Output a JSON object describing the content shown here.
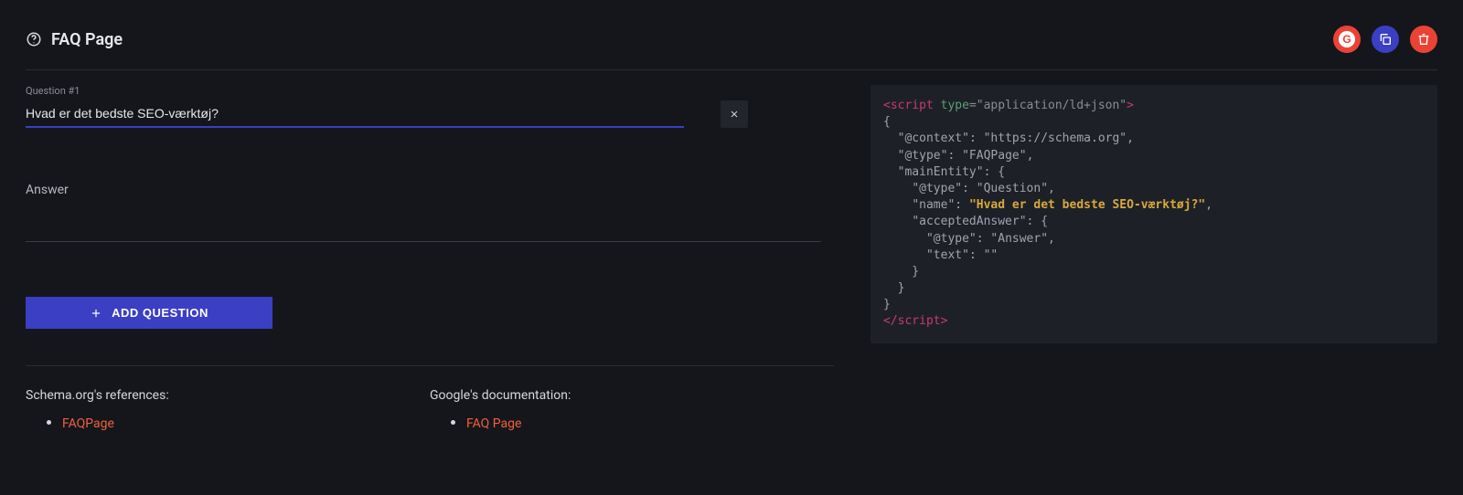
{
  "header": {
    "title": "FAQ Page"
  },
  "question": {
    "label": "Question #1",
    "value": "Hvad er det bedste SEO-værktøj?"
  },
  "answer": {
    "label": "Answer",
    "value": ""
  },
  "add_button": {
    "label": "ADD QUESTION"
  },
  "refs": {
    "schema_title": "Schema.org's references:",
    "schema_link": "FAQPage",
    "google_title": "Google's documentation:",
    "google_link": "FAQ Page"
  },
  "code": {
    "script_open": "script",
    "type_attr": "type",
    "type_val": "\"application/ld+json\"",
    "line_open_brace": "{",
    "context_key": "\"@context\"",
    "context_val": "\"https://schema.org\"",
    "type_key": "\"@type\"",
    "faqpage_val": "\"FAQPage\"",
    "mainentity_key": "\"mainEntity\"",
    "question_val": "\"Question\"",
    "name_key": "\"name\"",
    "name_val": "\"Hvad er det bedste SEO-værktøj?\"",
    "accepted_key": "\"acceptedAnswer\"",
    "answer_val": "\"Answer\"",
    "text_key": "\"text\"",
    "text_val": "\"\"",
    "close_brace": "}",
    "script_close": "script"
  }
}
